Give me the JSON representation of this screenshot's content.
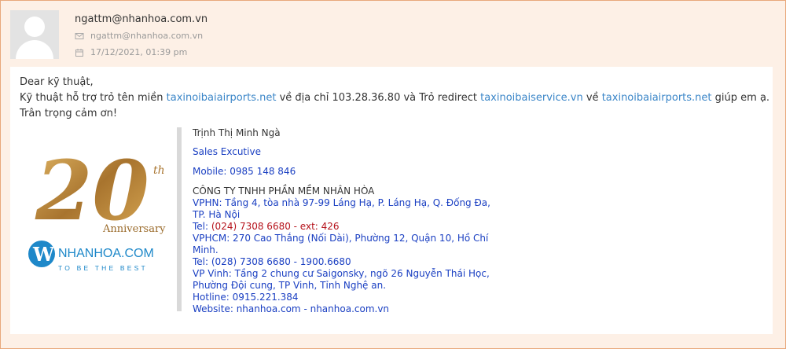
{
  "sender": {
    "name": "ngattm@nhanhoa.com.vn",
    "email": "ngattm@nhanhoa.com.vn",
    "date": "17/12/2021, 01:39 pm",
    "email_icon": "envelope-icon",
    "date_icon": "calendar-icon"
  },
  "message": {
    "greeting": "Dear kỹ thuật,",
    "line2_part1": "Kỹ thuật hỗ trợ trỏ tên miền ",
    "link1": "taxinoibaiairports.net",
    "line2_part2": " về địa chỉ 103.28.36.80 và Trỏ redirect ",
    "link2": "taxinoibaiservice.vn",
    "line2_part3": " về ",
    "link3": "taxinoibaiairports.net",
    "line2_part4": " giúp em ạ.",
    "closing": "Trân trọng cảm ơn!"
  },
  "logo": {
    "number": "20",
    "suffix": "th",
    "anniversary": "Anniversary",
    "w_letter": "W",
    "brand": "NHANHOA.COM",
    "tagline": "TO BE THE BEST"
  },
  "signature": {
    "name": "Trịnh Thị Minh Ngà",
    "title": "Sales Excutive",
    "mobile": "Mobile: 0985 148 846",
    "company": "CÔNG TY TNHH PHẦN MỀM NHÂN HÒA",
    "vphn_1": "VPHN: Tầng 4, tòa nhà 97-99 Láng Hạ, P. Láng Hạ, Q. Đống Đa,",
    "vphn_2": "TP. Hà Nội",
    "tel1_label": "Tel: ",
    "tel1_value": "(024) 7308 6680 - ext: 426",
    "vphcm_1": "VPHCM: 270 Cao Thắng (Nối Dài), Phường 12, Quận 10, Hồ Chí",
    "vphcm_2": "Minh.",
    "tel2": "Tel: (028) 7308 6680 - 1900.6680",
    "vinh_1": "VP Vinh: Tầng 2 chung cư Saigonsky, ngõ 26 Nguyễn Thái Học,",
    "vinh_2": "Phường Đội cung, TP Vinh, Tỉnh Nghệ an.",
    "hotline": "Hotline: 0915.221.384",
    "website_label": "Website: ",
    "website_link1": "nhanhoa.com",
    "website_sep": " -  ",
    "website_link2": "nhanhoa.com.vn"
  },
  "colors": {
    "page_bg": "#fdf0e6",
    "link": "#3b86c8",
    "signature_blue": "#1a3fc2",
    "signature_red": "#b5121b",
    "gold": "#b8863b",
    "brand_blue": "#1e88c9"
  }
}
